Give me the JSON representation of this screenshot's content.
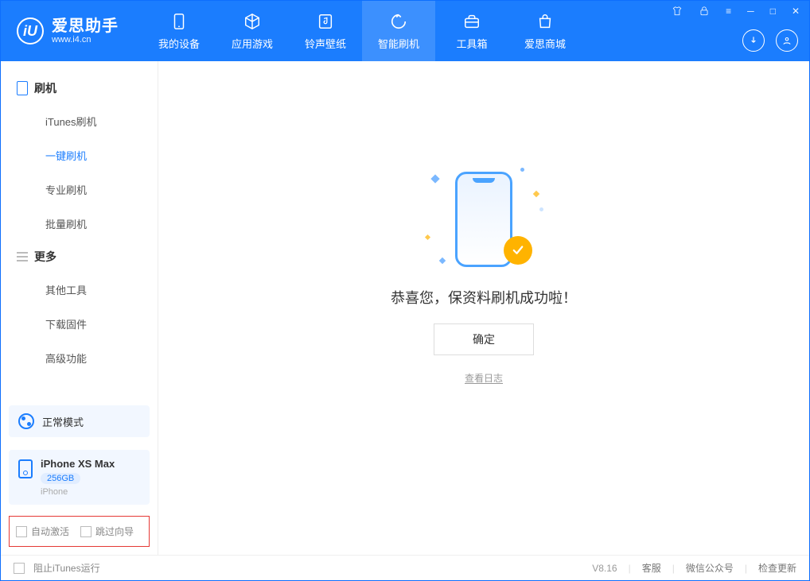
{
  "app": {
    "title": "爱思助手",
    "url": "www.i4.cn"
  },
  "nav": {
    "items": [
      {
        "label": "我的设备"
      },
      {
        "label": "应用游戏"
      },
      {
        "label": "铃声壁纸"
      },
      {
        "label": "智能刷机"
      },
      {
        "label": "工具箱"
      },
      {
        "label": "爱思商城"
      }
    ]
  },
  "sidebar": {
    "section1": "刷机",
    "items1": [
      {
        "label": "iTunes刷机"
      },
      {
        "label": "一键刷机"
      },
      {
        "label": "专业刷机"
      },
      {
        "label": "批量刷机"
      }
    ],
    "section2": "更多",
    "items2": [
      {
        "label": "其他工具"
      },
      {
        "label": "下载固件"
      },
      {
        "label": "高级功能"
      }
    ],
    "mode": "正常模式",
    "device": {
      "name": "iPhone XS Max",
      "capacity": "256GB",
      "type": "iPhone"
    },
    "opts": {
      "auto_activate": "自动激活",
      "skip_guide": "跳过向导"
    }
  },
  "main": {
    "success": "恭喜您，保资料刷机成功啦！",
    "ok": "确定",
    "view_log": "查看日志"
  },
  "footer": {
    "stop_itunes": "阻止iTunes运行",
    "version": "V8.16",
    "links": [
      "客服",
      "微信公众号",
      "检查更新"
    ]
  }
}
